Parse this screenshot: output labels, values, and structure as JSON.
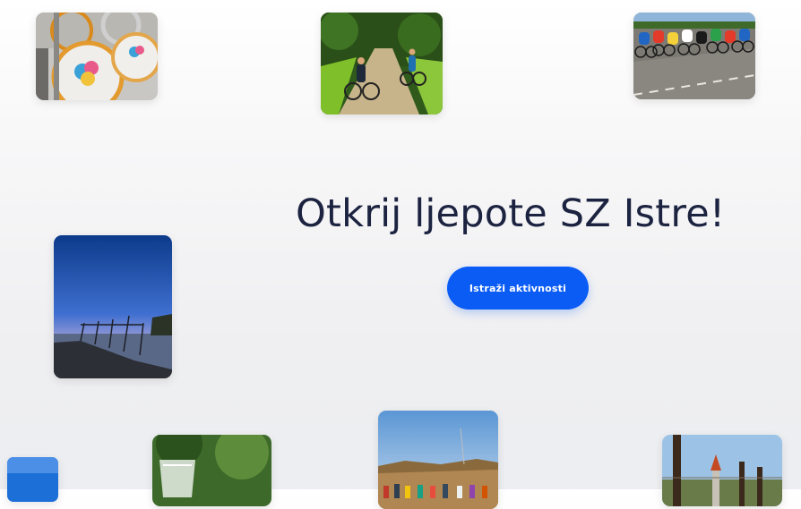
{
  "hero": {
    "title": "Otkrij ljepote SZ Istre!",
    "cta_label": "Istraži aktivnosti"
  },
  "colors": {
    "cta_background": "#0a5cf5",
    "title_text": "#1c2340"
  }
}
